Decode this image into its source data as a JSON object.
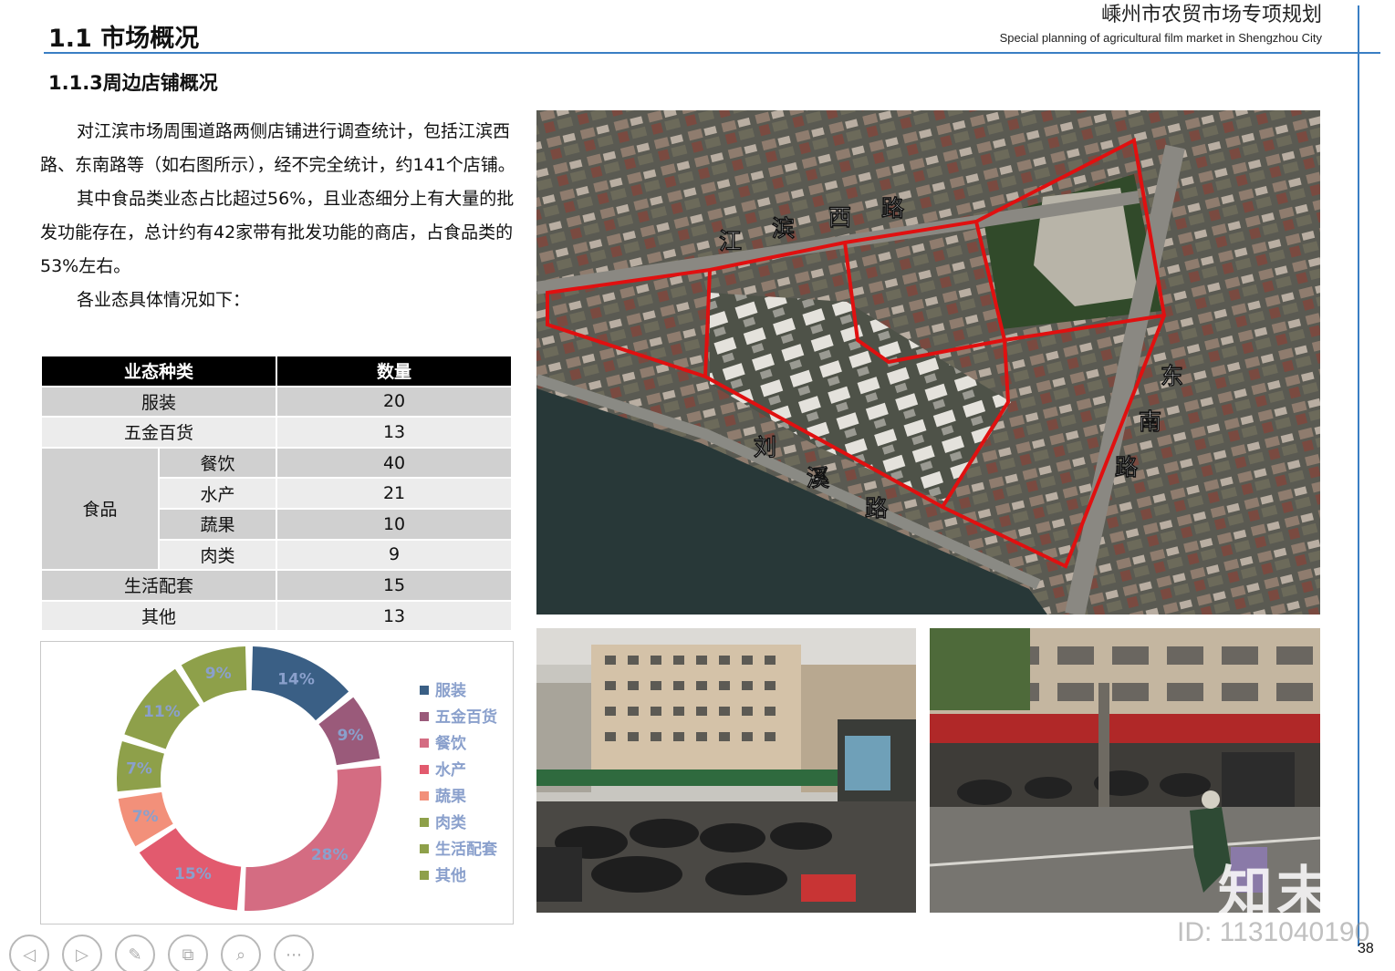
{
  "header": {
    "section_title": "1.1 市场概况",
    "doc_title": "嵊州市农贸市场专项规划",
    "doc_subtitle": "Special planning of agricultural film market in Shengzhou City"
  },
  "subsection_title": "1.1.3周边店铺概况",
  "body_paragraphs": [
    "对江滨市场周围道路两侧店铺进行调查统计，包括江滨西路、东南路等（如右图所示），经不完全统计，约141个店铺。",
    "其中食品类业态占比超过56%，且业态细分上有大量的批发功能存在，总计约有42家带有批发功能的商店，占食品类的53%左右。",
    "各业态具体情况如下："
  ],
  "table": {
    "headers": [
      "业态种类",
      "数量"
    ],
    "food_group": "食品",
    "rows": [
      {
        "name": "服装",
        "count": "20"
      },
      {
        "name": "五金百货",
        "count": "13"
      },
      {
        "name": "餐饮",
        "count": "40"
      },
      {
        "name": "水产",
        "count": "21"
      },
      {
        "name": "蔬果",
        "count": "10"
      },
      {
        "name": "肉类",
        "count": "9"
      },
      {
        "name": "生活配套",
        "count": "15"
      },
      {
        "name": "其他",
        "count": "13"
      }
    ]
  },
  "chart_data": {
    "type": "pie",
    "categories": [
      "服装",
      "五金百货",
      "餐饮",
      "水产",
      "蔬果",
      "肉类",
      "生活配套",
      "其他"
    ],
    "values": [
      14,
      9,
      28,
      15,
      7,
      7,
      11,
      9
    ],
    "data_labels": [
      "14%",
      "9%",
      "28%",
      "15%",
      "7%",
      "7%",
      "11%",
      "9%"
    ],
    "colors": [
      "#3a5f85",
      "#9a5a7a",
      "#d46c82",
      "#e25a6e",
      "#f2907a",
      "#8ea04a",
      "#8ea04a",
      "#8ea04a"
    ],
    "legend_position": "right",
    "legend_text_color": "#8aa0cc"
  },
  "map": {
    "road_labels": [
      "江",
      "滨",
      "西",
      "路",
      "东",
      "南",
      "路",
      "刘",
      "溪",
      "路"
    ],
    "boundary_color": "#e01010"
  },
  "watermark": {
    "logo": "知末",
    "id": "ID: 1131040190"
  },
  "page_number": "38",
  "nav_icons": [
    "prev-icon",
    "next-icon",
    "pen-icon",
    "copy-icon",
    "zoom-icon",
    "more-icon"
  ]
}
